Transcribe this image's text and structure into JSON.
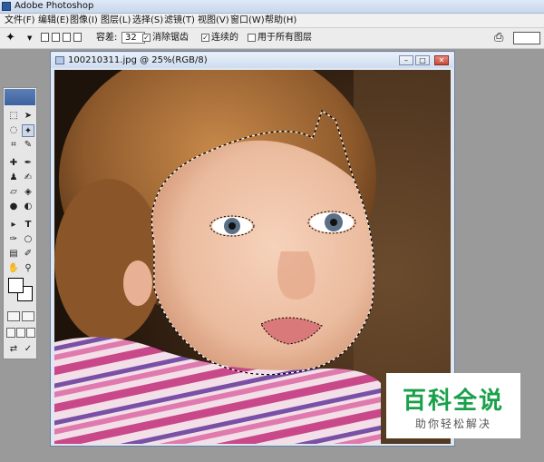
{
  "app": {
    "title": "Adobe Photoshop"
  },
  "menu": [
    "文件(F)",
    "编辑(E)",
    "图像(I)",
    "图层(L)",
    "选择(S)",
    "滤镜(T)",
    "视图(V)",
    "窗口(W)",
    "帮助(H)"
  ],
  "options": {
    "tolerance_label": "容差:",
    "tolerance_value": "32",
    "antialias_label": "消除锯齿",
    "antialias_checked": true,
    "contiguous_label": "连续的",
    "contiguous_checked": true,
    "all_layers_label": "用于所有图层",
    "all_layers_checked": false
  },
  "document": {
    "title": "100210311.jpg @ 25%(RGB/8)"
  },
  "watermark": {
    "main": "百科全说",
    "sub": "助你轻松解决"
  },
  "colors": {
    "accent": "#1aa04a",
    "titlebar": "#dfe9f7",
    "workspace": "#9a9a9a"
  }
}
